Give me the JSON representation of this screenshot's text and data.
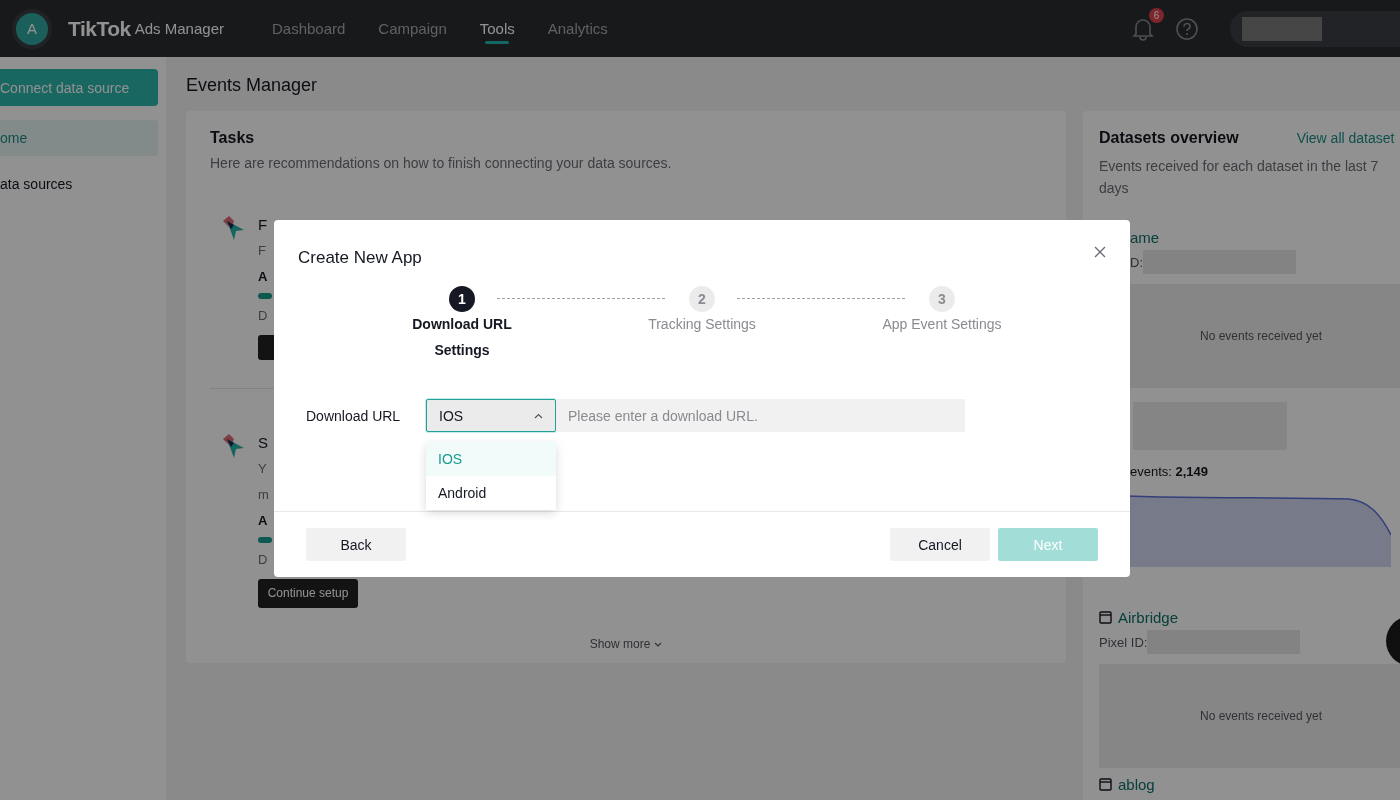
{
  "header": {
    "avatar": "A",
    "logo": "TikTok",
    "logo_suffix": "Ads Manager",
    "nav": [
      {
        "label": "Dashboard",
        "selected": false
      },
      {
        "label": "Campaign",
        "selected": false
      },
      {
        "label": "Tools",
        "selected": true
      },
      {
        "label": "Analytics",
        "selected": false
      }
    ],
    "notification_count": "6"
  },
  "sidebar": {
    "primary_button": "Connect data source",
    "items": [
      {
        "label": "ome",
        "selected": true
      },
      {
        "label": "ata sources",
        "selected": false
      }
    ]
  },
  "page_title": "Events Manager",
  "tasks": {
    "title": "Tasks",
    "description": "Here are recommendations on how to finish connecting your data sources.",
    "items": [
      {
        "title": "F",
        "description_lines": [
          "F"
        ],
        "label": "A",
        "status": "D"
      },
      {
        "title": "S",
        "description_lines": [
          "Y",
          "m"
        ],
        "label": "A",
        "status": "D",
        "button": "Continue setup"
      }
    ],
    "show_more": "Show more"
  },
  "datasets": {
    "title": "Datasets overview",
    "link": "View all dataset",
    "description": "Events received for each dataset in the last 7 days",
    "items": [
      {
        "kind": "empty",
        "name": "ame",
        "has_icon": false,
        "id_label": "D:",
        "empty_text": "No events received yet"
      },
      {
        "kind": "chart",
        "total": "events: **2,149**"
      },
      {
        "kind": "empty",
        "name": "Airbridge",
        "has_icon": true,
        "id_label": "Pixel ID:",
        "empty_text": "No events received yet"
      },
      {
        "kind": "title_only",
        "name": "ablog",
        "has_icon": true
      }
    ]
  },
  "modal": {
    "title": "Create New App",
    "steps": [
      {
        "number": "1",
        "label": "Download URL Settings",
        "selected": true
      },
      {
        "number": "2",
        "label": "Tracking Settings",
        "selected": false
      },
      {
        "number": "3",
        "label": "App Event Settings",
        "selected": false
      }
    ],
    "field_label": "Download URL",
    "select": {
      "value": "IOS",
      "expanded": true,
      "options": [
        {
          "label": "IOS",
          "selected": true
        },
        {
          "label": "Android",
          "selected": false
        }
      ]
    },
    "url_placeholder": "Please enter a download URL.",
    "buttons": {
      "back": "Back",
      "cancel": "Cancel",
      "next": "Next",
      "next_disabled": true
    }
  }
}
